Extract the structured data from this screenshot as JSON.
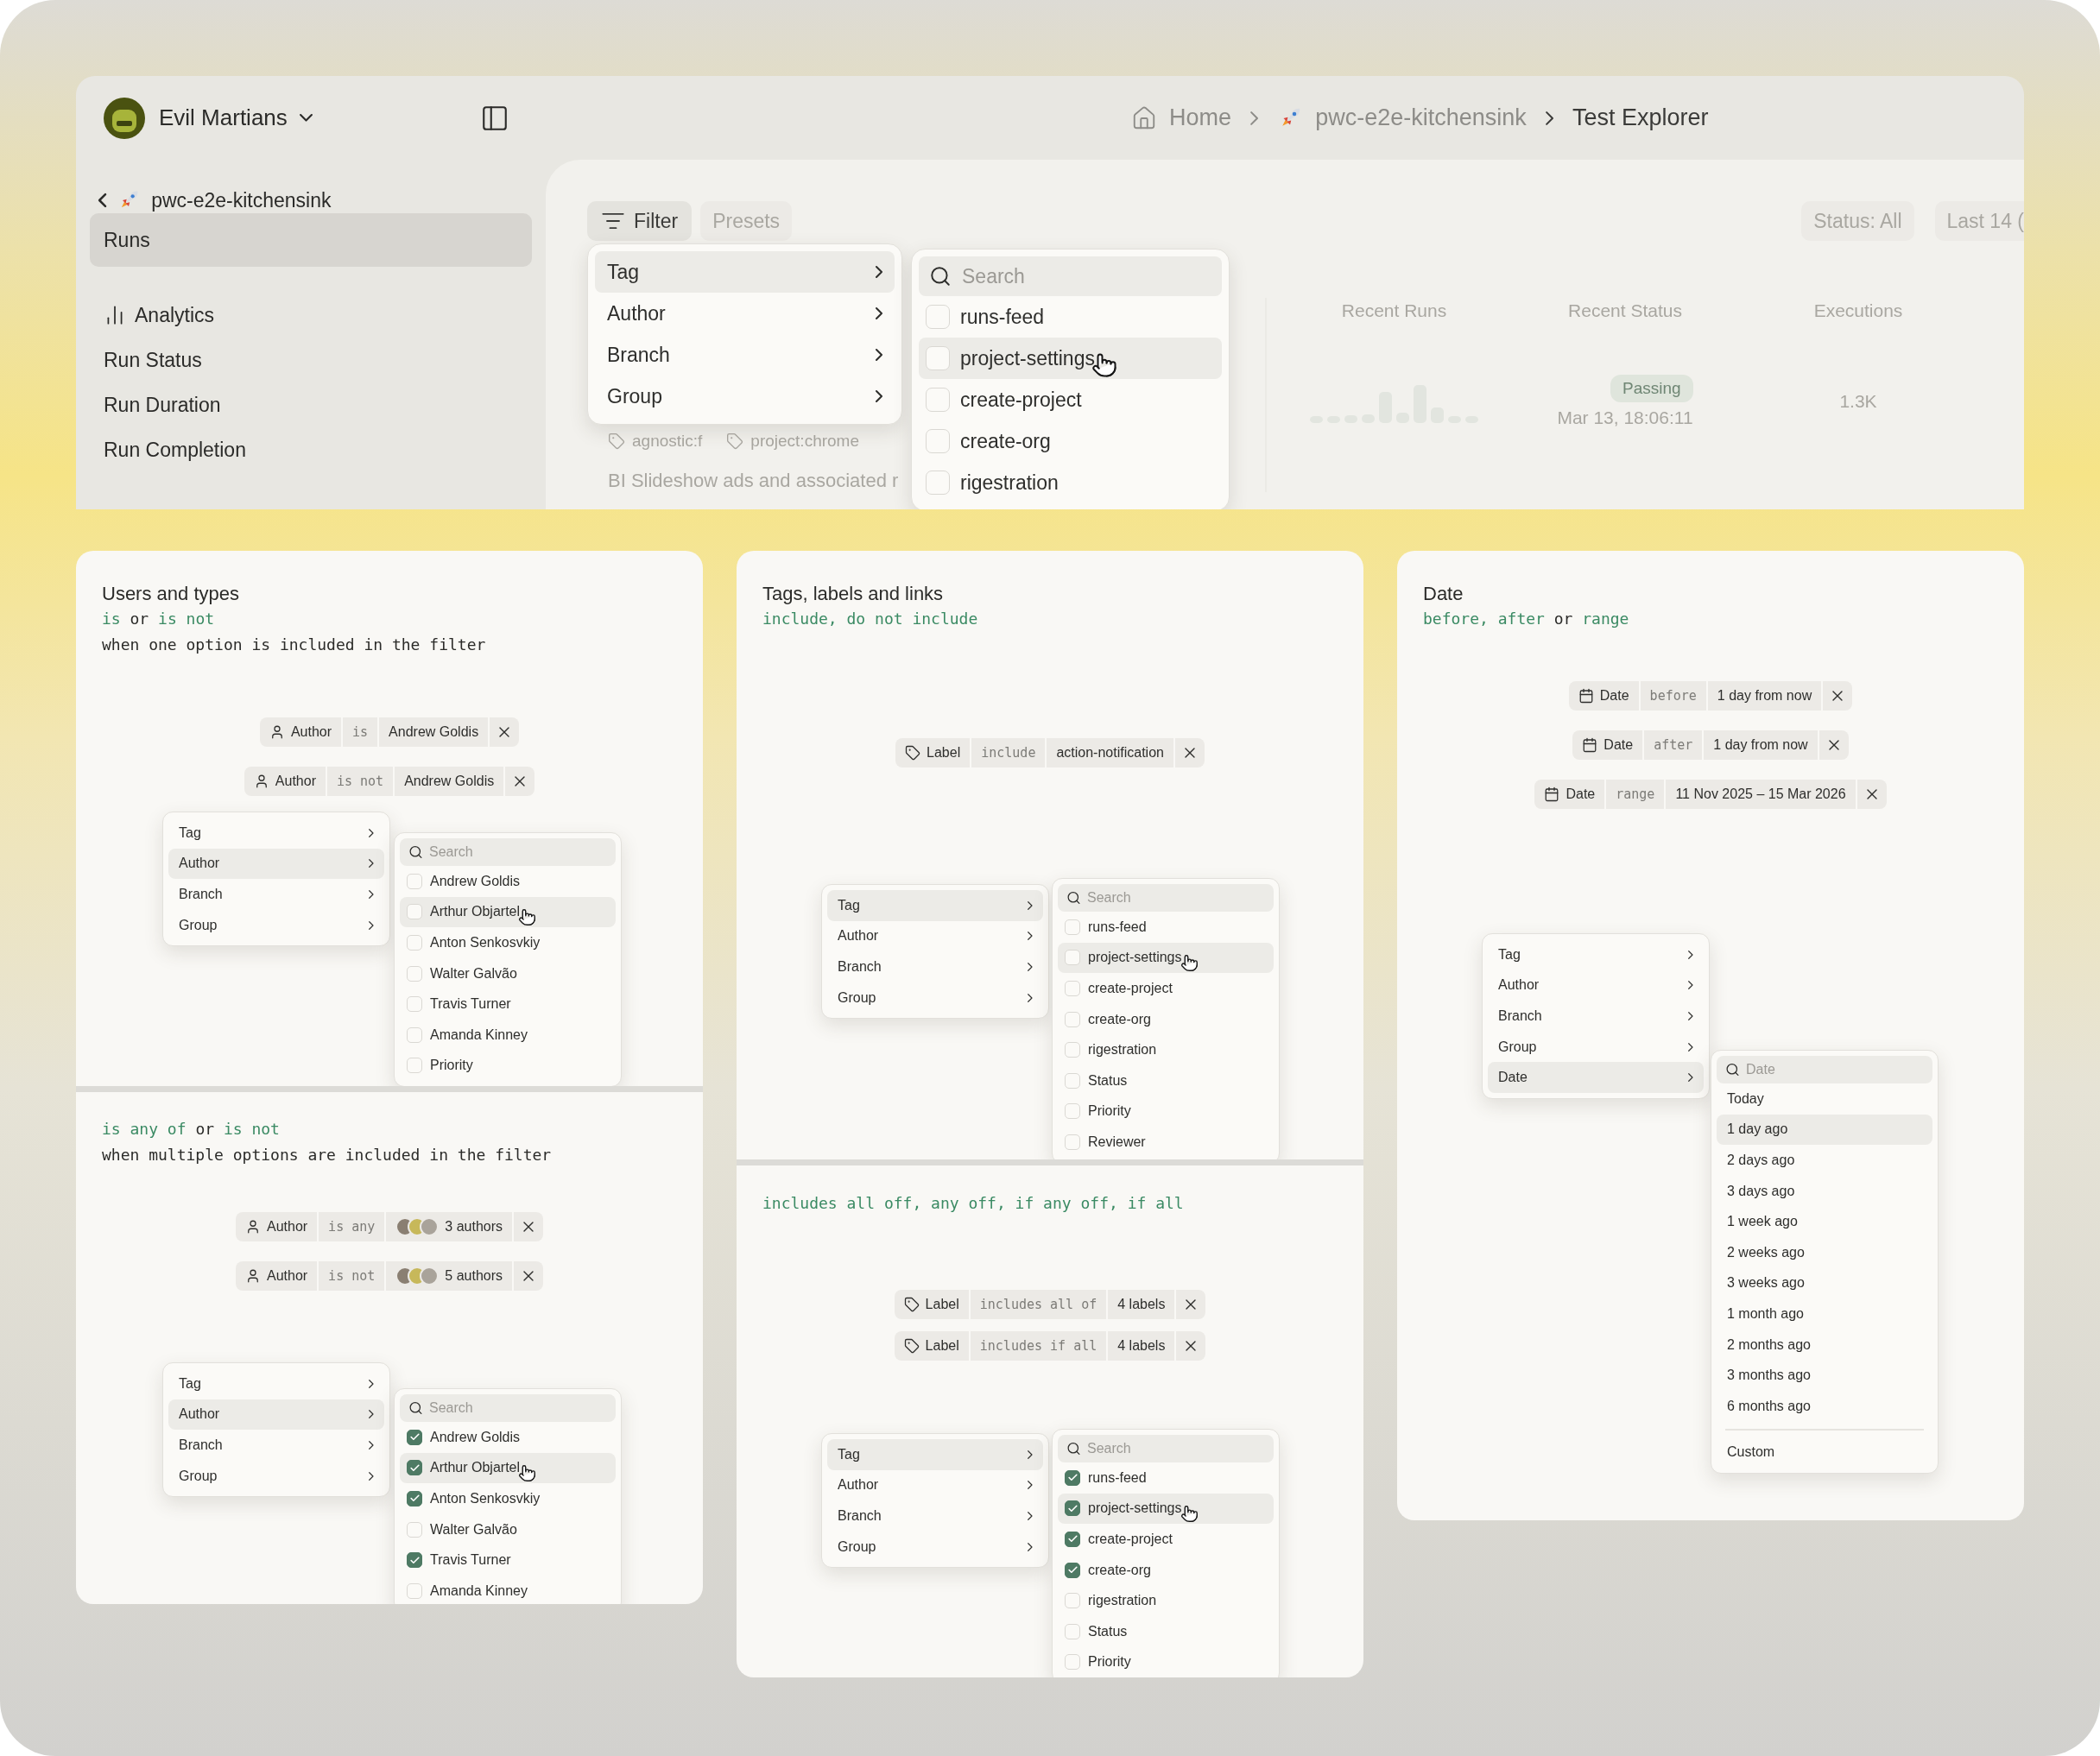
{
  "app": {
    "org": "Evil Martians",
    "breadcrumbs": [
      {
        "label": "Home",
        "kind": "home"
      },
      {
        "label": "pwc-e2e-kitchensink",
        "kind": "project"
      },
      {
        "label": "Test Explorer",
        "kind": "current"
      }
    ],
    "sidebar": {
      "back": "pwc-e2e-kitchensink",
      "items": [
        {
          "label": "Runs",
          "kind": "page",
          "selected": true
        },
        {
          "label": "Analytics",
          "kind": "heading",
          "selected": false
        },
        {
          "label": "Run Status",
          "kind": "page",
          "selected": false
        },
        {
          "label": "Run Duration",
          "kind": "page",
          "selected": false
        },
        {
          "label": "Run Completion",
          "kind": "page",
          "selected": false
        }
      ]
    },
    "toolbar": {
      "filter": "Filter",
      "presets": "Presets",
      "status": "Status: All",
      "period": "Last 14 ("
    },
    "table": {
      "columns": [
        "Recent Runs",
        "Recent Status",
        "Executions"
      ],
      "tags": [
        "agnostic:f",
        "project:chrome"
      ],
      "title": "BI Slideshow ads and associated r",
      "status": "Passing",
      "time": "Mar 13, 18:06:11",
      "executions": "1.3K"
    },
    "menu": {
      "kind": "checklist",
      "cursor": true,
      "placeholder": "Search",
      "categories": [
        {
          "label": "Tag",
          "selected": true
        },
        {
          "label": "Author",
          "selected": false
        },
        {
          "label": "Branch",
          "selected": false
        },
        {
          "label": "Group",
          "selected": false
        }
      ],
      "options": [
        {
          "label": "runs-feed",
          "checked": false,
          "selected": false
        },
        {
          "label": "project-settings",
          "checked": false,
          "selected": true
        },
        {
          "label": "create-project",
          "checked": false,
          "selected": false
        },
        {
          "label": "create-org",
          "checked": false,
          "selected": false
        },
        {
          "label": "rigestration",
          "checked": false,
          "selected": false
        }
      ]
    }
  },
  "panels": [
    {
      "title": "Users and types",
      "sections": [
        {
          "summary": [
            {
              "text": "is",
              "keyword": true
            },
            {
              "text": " or ",
              "keyword": false
            },
            {
              "text": "is not",
              "keyword": true
            }
          ],
          "note": "when one option is included in the filter",
          "chips": [
            {
              "kind": "author",
              "field": "Author",
              "operator": "is",
              "value": "Andrew Goldis"
            },
            {
              "kind": "author",
              "field": "Author",
              "operator": "is not",
              "value": "Andrew Goldis"
            }
          ],
          "menu": {
            "kind": "checklist",
            "cursor": true,
            "placeholder": "Search",
            "categories": [
              {
                "label": "Tag",
                "selected": false
              },
              {
                "label": "Author",
                "selected": true
              },
              {
                "label": "Branch",
                "selected": false
              },
              {
                "label": "Group",
                "selected": false
              }
            ],
            "options": [
              {
                "label": "Andrew Goldis",
                "checked": false,
                "selected": false
              },
              {
                "label": "Arthur Objartel",
                "checked": false,
                "selected": true
              },
              {
                "label": "Anton Senkosvkiy",
                "checked": false,
                "selected": false
              },
              {
                "label": "Walter Galvão",
                "checked": false,
                "selected": false
              },
              {
                "label": "Travis Turner",
                "checked": false,
                "selected": false
              },
              {
                "label": "Amanda Kinney",
                "checked": false,
                "selected": false
              },
              {
                "label": "Priority",
                "checked": false,
                "selected": false
              }
            ]
          }
        },
        {
          "summary": [
            {
              "text": "is any of",
              "keyword": true
            },
            {
              "text": " or ",
              "keyword": false
            },
            {
              "text": "is not",
              "keyword": true
            }
          ],
          "note": "when multiple options are included in the filter",
          "chips": [
            {
              "kind": "authors",
              "field": "Author",
              "operator": "is any",
              "value": "3 authors"
            },
            {
              "kind": "authors",
              "field": "Author",
              "operator": "is not",
              "value": "5 authors"
            }
          ],
          "menu": {
            "kind": "checklist",
            "cursor": true,
            "placeholder": "Search",
            "categories": [
              {
                "label": "Tag",
                "selected": false
              },
              {
                "label": "Author",
                "selected": true
              },
              {
                "label": "Branch",
                "selected": false
              },
              {
                "label": "Group",
                "selected": false
              }
            ],
            "options": [
              {
                "label": "Andrew Goldis",
                "checked": true,
                "selected": false
              },
              {
                "label": "Arthur Objartel",
                "checked": true,
                "selected": true
              },
              {
                "label": "Anton Senkosvkiy",
                "checked": true,
                "selected": false
              },
              {
                "label": "Walter Galvão",
                "checked": false,
                "selected": false
              },
              {
                "label": "Travis Turner",
                "checked": true,
                "selected": false
              },
              {
                "label": "Amanda Kinney",
                "checked": false,
                "selected": false
              }
            ]
          }
        }
      ]
    },
    {
      "title": "Tags, labels and links",
      "sections": [
        {
          "summary": [
            {
              "text": "include, do not include",
              "keyword": true
            }
          ],
          "chips": [
            {
              "kind": "label",
              "field": "Label",
              "operator": "include",
              "value": "action-notification"
            }
          ],
          "menu": {
            "kind": "checklist",
            "cursor": true,
            "placeholder": "Search",
            "categories": [
              {
                "label": "Tag",
                "selected": true
              },
              {
                "label": "Author",
                "selected": false
              },
              {
                "label": "Branch",
                "selected": false
              },
              {
                "label": "Group",
                "selected": false
              }
            ],
            "options": [
              {
                "label": "runs-feed",
                "checked": false,
                "selected": false
              },
              {
                "label": "project-settings",
                "checked": false,
                "selected": true
              },
              {
                "label": "create-project",
                "checked": false,
                "selected": false
              },
              {
                "label": "create-org",
                "checked": false,
                "selected": false
              },
              {
                "label": "rigestration",
                "checked": false,
                "selected": false
              },
              {
                "label": "Status",
                "checked": false,
                "selected": false
              },
              {
                "label": "Priority",
                "checked": false,
                "selected": false
              },
              {
                "label": "Reviewer",
                "checked": false,
                "selected": false
              }
            ]
          }
        },
        {
          "summary": [
            {
              "text": "includes all off, any off, if any off, if all",
              "keyword": true
            }
          ],
          "chips": [
            {
              "kind": "label",
              "field": "Label",
              "operator": "includes all of",
              "value": "4 labels"
            },
            {
              "kind": "label",
              "field": "Label",
              "operator": "includes if all",
              "value": "4 labels"
            }
          ],
          "menu": {
            "kind": "checklist",
            "cursor": true,
            "placeholder": "Search",
            "categories": [
              {
                "label": "Tag",
                "selected": true
              },
              {
                "label": "Author",
                "selected": false
              },
              {
                "label": "Branch",
                "selected": false
              },
              {
                "label": "Group",
                "selected": false
              }
            ],
            "options": [
              {
                "label": "runs-feed",
                "checked": true,
                "selected": false
              },
              {
                "label": "project-settings",
                "checked": true,
                "selected": true
              },
              {
                "label": "create-project",
                "checked": true,
                "selected": false
              },
              {
                "label": "create-org",
                "checked": true,
                "selected": false
              },
              {
                "label": "rigestration",
                "checked": false,
                "selected": false
              },
              {
                "label": "Status",
                "checked": false,
                "selected": false
              },
              {
                "label": "Priority",
                "checked": false,
                "selected": false
              }
            ]
          }
        }
      ]
    },
    {
      "title": "Date",
      "sections": [
        {
          "summary": [
            {
              "text": "before, ",
              "keyword": true
            },
            {
              "text": "after",
              "keyword": true
            },
            {
              "text": " or ",
              "keyword": false
            },
            {
              "text": "range",
              "keyword": true
            }
          ],
          "chips": [
            {
              "kind": "date",
              "field": "Date",
              "operator": "before",
              "value": "1 day from now"
            },
            {
              "kind": "date",
              "field": "Date",
              "operator": "after",
              "value": "1 day from now"
            },
            {
              "kind": "date",
              "field": "Date",
              "operator": "range",
              "value": "11 Nov 2025 – 15 Mar 2026"
            }
          ],
          "menu": {
            "kind": "plain",
            "cursor": false,
            "placeholder": "Date",
            "categories": [
              {
                "label": "Tag",
                "selected": false
              },
              {
                "label": "Author",
                "selected": false
              },
              {
                "label": "Branch",
                "selected": false
              },
              {
                "label": "Group",
                "selected": false
              },
              {
                "label": "Date",
                "selected": true
              }
            ],
            "options": [
              {
                "label": "Today",
                "selected": false
              },
              {
                "label": "1 day ago",
                "selected": true
              },
              {
                "label": "2 days ago",
                "selected": false
              },
              {
                "label": "3 days ago",
                "selected": false
              },
              {
                "label": "1 week ago",
                "selected": false
              },
              {
                "label": "2 weeks ago",
                "selected": false
              },
              {
                "label": "3 weeks ago",
                "selected": false
              },
              {
                "label": "1 month ago",
                "selected": false
              },
              {
                "label": "2 months ago",
                "selected": false
              },
              {
                "label": "3 months ago",
                "selected": false
              },
              {
                "label": "6 months ago",
                "selected": false
              }
            ],
            "footer": "Custom"
          }
        }
      ]
    }
  ]
}
